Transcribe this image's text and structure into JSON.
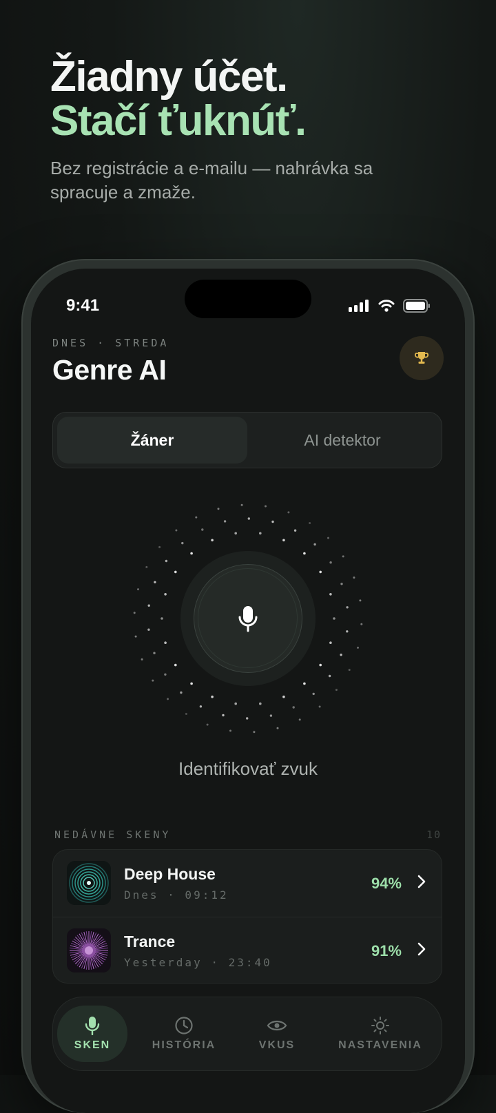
{
  "hero": {
    "title_line1": "Žiadny účet.",
    "title_line2": "Stačí ťuknúť.",
    "subtitle": "Bez registrácie a e-mailu — nahrávka sa spracuje a zmaže."
  },
  "status_bar": {
    "time": "9:41"
  },
  "header": {
    "date_label": "DNES · STREDA",
    "app_title": "Genre AI"
  },
  "segmented": {
    "tabs": [
      "Žáner",
      "AI detektor"
    ],
    "active_index": 0
  },
  "scan": {
    "action_label": "Identifikovať zvuk"
  },
  "recent": {
    "label": "NEDÁVNE SKENY",
    "count": "10",
    "items": [
      {
        "title": "Deep House",
        "meta": "Dnes · 09:12",
        "confidence": "94%"
      },
      {
        "title": "Trance",
        "meta": "Yesterday · 23:40",
        "confidence": "91%"
      }
    ]
  },
  "tabbar": {
    "items": [
      {
        "label": "SKEN",
        "icon": "mic-icon"
      },
      {
        "label": "HISTÓRIA",
        "icon": "clock-icon"
      },
      {
        "label": "VKUS",
        "icon": "eye-icon"
      },
      {
        "label": "NASTAVENIA",
        "icon": "sun-icon"
      }
    ],
    "active_index": 0
  },
  "colors": {
    "accent_green": "#a8e2b3",
    "background": "#141615",
    "trophy_gold": "#e3b94f"
  }
}
